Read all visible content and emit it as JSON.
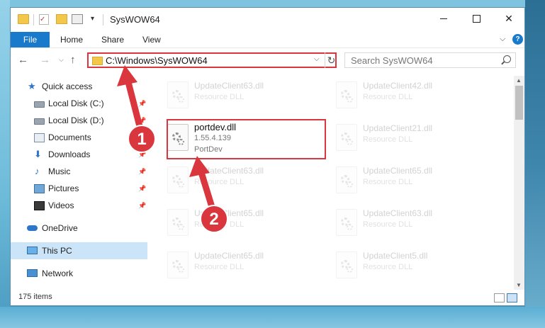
{
  "window": {
    "title": "SysWOW64",
    "minimize": "—",
    "maximize": "☐",
    "close": "✕"
  },
  "ribbon": {
    "tabs": [
      "File",
      "Home",
      "Share",
      "View"
    ],
    "help": "?"
  },
  "address": {
    "path": "C:\\Windows\\SysWOW64",
    "refresh": "↻",
    "dropdown": "⌵"
  },
  "search": {
    "placeholder": "Search SysWOW64"
  },
  "sidebar": {
    "items": [
      {
        "label": "Quick access",
        "icon": "star-icon"
      },
      {
        "label": "Local Disk (C:)",
        "icon": "drive-icon",
        "pinned": true
      },
      {
        "label": "Local Disk (D:)",
        "icon": "drive-icon",
        "pinned": true
      },
      {
        "label": "Documents",
        "icon": "documents-icon",
        "pinned": true
      },
      {
        "label": "Downloads",
        "icon": "download-icon",
        "pinned": true
      },
      {
        "label": "Music",
        "icon": "music-icon",
        "pinned": true
      },
      {
        "label": "Pictures",
        "icon": "pictures-icon",
        "pinned": true
      },
      {
        "label": "Videos",
        "icon": "videos-icon",
        "pinned": true
      },
      {
        "label": "OneDrive",
        "icon": "cloud-icon"
      },
      {
        "label": "This PC",
        "icon": "computer-icon",
        "selected": true
      },
      {
        "label": "Network",
        "icon": "network-icon"
      }
    ]
  },
  "files": {
    "highlighted": {
      "name": "portdev.dll",
      "version": "1.55.4.139",
      "description": "PortDev"
    },
    "faded": [
      {
        "name": "UpdateClient63.dll",
        "type": "Resource DLL"
      },
      {
        "name": "UpdateClient42.dll",
        "type": "Resource DLL"
      },
      {
        "name": "UpdateClient21.dll",
        "type": "Resource DLL"
      },
      {
        "name": "UpdateClient63.dll",
        "type": "Resource DLL"
      },
      {
        "name": "UpdateClient65.dll",
        "type": "Resource DLL"
      },
      {
        "name": "UpdateClient65.dll",
        "type": "Resource DLL"
      },
      {
        "name": "UpdateClient63.dll",
        "type": "Resource DLL"
      },
      {
        "name": "UpdateClient65.dll",
        "type": "Resource DLL"
      },
      {
        "name": "UpdateClient5.dll",
        "type": "Resource DLL"
      }
    ]
  },
  "status": {
    "count": "175 items"
  },
  "annotations": {
    "step1": "1",
    "step2": "2"
  },
  "colors": {
    "accent": "#1979ca",
    "highlight": "#d9363e",
    "selection": "#cce4f7"
  }
}
